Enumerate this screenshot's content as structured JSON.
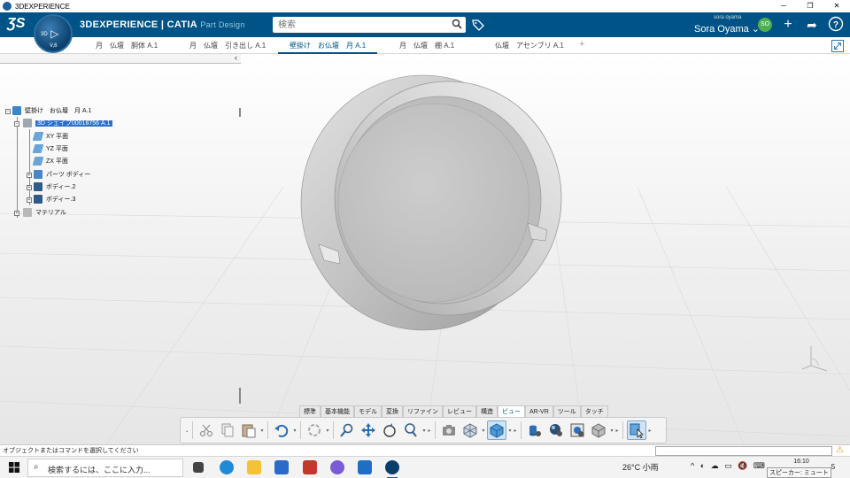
{
  "window": {
    "title": "3DEXPERIENCE",
    "minimize": "─",
    "restore": "❐",
    "close": "✕"
  },
  "topbar": {
    "brand_bold": "3DEXPERIENCE | CATIA",
    "brand_app": "Part Design",
    "compass_3d": "3D",
    "compass_version": "V,6",
    "search_placeholder": "検索",
    "user_small": "sora oyama",
    "user_name": "Sora Oyama ⌄",
    "avatar": "SO",
    "icons": [
      "plus-icon",
      "share-icon",
      "help-icon"
    ]
  },
  "tabs": [
    {
      "label": "月　仏壇　胴体 A.1",
      "active": false
    },
    {
      "label": "月　仏壇　引き出し A.1",
      "active": false
    },
    {
      "label": "壁掛け　お仏壇　月 A.1",
      "active": true
    },
    {
      "label": "月　仏壇　棚 A.1",
      "active": false
    },
    {
      "label": "仏壇　アセンブリ A.1",
      "active": false
    }
  ],
  "add_tab": "+",
  "panel_collapse": "‹",
  "tree": {
    "root": "壁掛け　お仏壇　月 A.1",
    "items": [
      {
        "label": "3D シェイプ00018756 A.1",
        "selected": true
      },
      {
        "label": "XY 平面"
      },
      {
        "label": "YZ 平面"
      },
      {
        "label": "ZX 平面"
      },
      {
        "label": "パーツ ボディー"
      },
      {
        "label": "ボディー.2"
      },
      {
        "label": "ボディー.3"
      },
      {
        "label": "マテリアル"
      }
    ]
  },
  "section_tabs": [
    "標準",
    "基本機能",
    "モデル",
    "変換",
    "リファイン",
    "レビュー",
    "構造",
    "ビュー",
    "AR-VR",
    "ツール",
    "タッチ"
  ],
  "active_section": "ビュー",
  "toolbar_icons": [
    "cut-icon",
    "copy-icon",
    "paste-icon",
    "undo-icon",
    "update-icon",
    "fly-zoom-icon",
    "pan-icon",
    "rotate-icon",
    "zoom-icon",
    "capture-icon",
    "view-orientation-icon",
    "shading-icon",
    "hide-show-icon",
    "material-icon",
    "render-icon",
    "visual-quality-icon",
    "selection-icon"
  ],
  "status": {
    "message": "オブジェクトまたはコマンドを選択してください"
  },
  "taskbar": {
    "search_placeholder": "検索するには、ここに入力...",
    "weather": "26°C 小雨",
    "time": "16:10",
    "tooltip": "スピーカー: ミュート",
    "notifications": "5"
  },
  "colors": {
    "brand_blue": "#005386",
    "selection_blue": "#2c6fd0",
    "model_gray": "#c8c8c8"
  }
}
